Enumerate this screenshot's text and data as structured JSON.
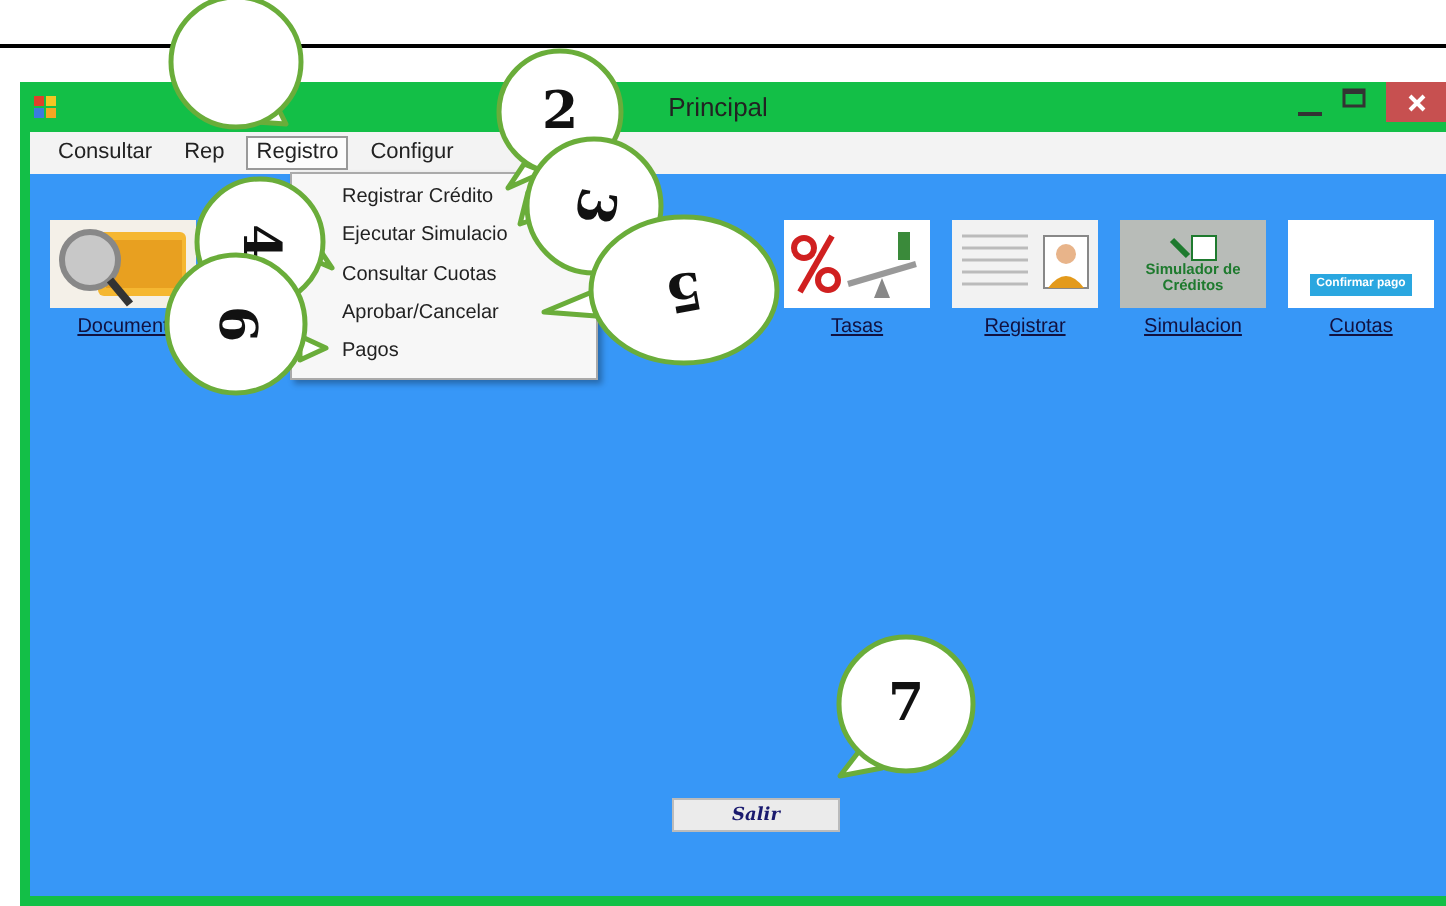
{
  "window": {
    "title": "Principal"
  },
  "menu": [
    {
      "label": "Consultar",
      "selected": false
    },
    {
      "label": "Rep",
      "selected": false
    },
    {
      "label": "Registro",
      "selected": true
    },
    {
      "label": "Configur",
      "selected": false
    }
  ],
  "dropdown": [
    "Registrar Crédito",
    "Ejecutar Simulacio",
    "Consultar Cuotas",
    "Aprobar/Cancelar",
    "Pagos"
  ],
  "shortcuts": [
    {
      "kind": "documents",
      "label": "Document"
    },
    {
      "kind": "rates",
      "label": "Tasas"
    },
    {
      "kind": "register",
      "label": "Registrar"
    },
    {
      "kind": "simulator",
      "label": "Simulacion",
      "caption": "Simulador de Créditos"
    },
    {
      "kind": "payments",
      "label": "Cuotas",
      "caption": "Confirmar pago"
    }
  ],
  "exit_button": "Salir",
  "callouts": [
    {
      "kind": "empty"
    },
    {
      "kind": "numbered",
      "number": "2"
    },
    {
      "kind": "numbered",
      "number": "3"
    },
    {
      "kind": "numbered",
      "number": "4"
    },
    {
      "kind": "numbered",
      "number": "5"
    },
    {
      "kind": "numbered",
      "number": "6"
    },
    {
      "kind": "numbered",
      "number": "7"
    }
  ]
}
